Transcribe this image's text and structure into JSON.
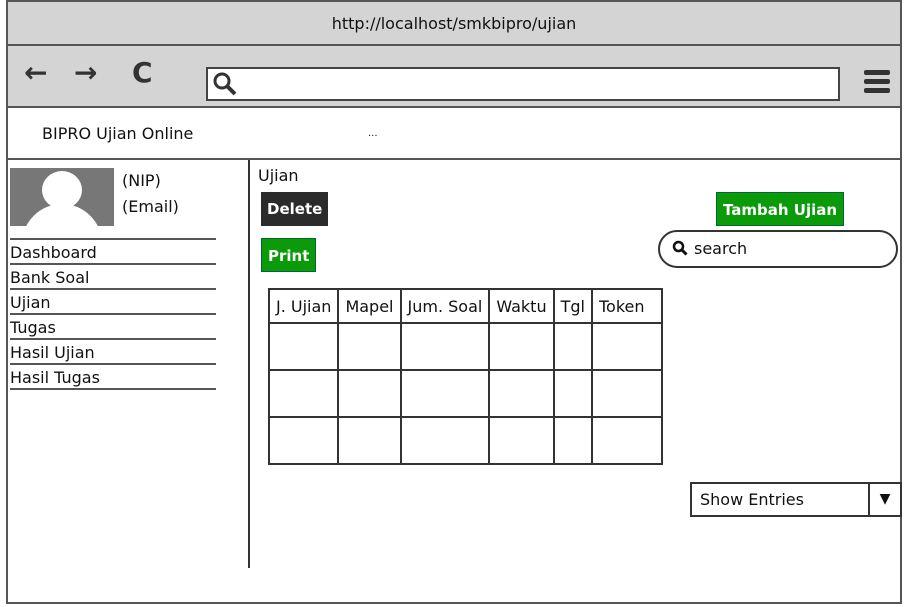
{
  "browser": {
    "url": "http://localhost/smkbipro/ujian",
    "back_icon": "←",
    "forward_icon": "→",
    "reload_icon": "C",
    "search_icon": "⚲"
  },
  "app": {
    "brand": "BIPRO Ujian Online",
    "dots": "..."
  },
  "profile": {
    "nip": "(NIP)",
    "email": "(Email)"
  },
  "sidebar": {
    "items": [
      {
        "label": "Dashboard"
      },
      {
        "label": "Bank Soal"
      },
      {
        "label": "Ujian"
      },
      {
        "label": "Tugas"
      },
      {
        "label": "Hasil Ujian"
      },
      {
        "label": "Hasil Tugas"
      }
    ]
  },
  "main": {
    "title": "Ujian",
    "delete_label": "Delete",
    "print_label": "Print",
    "add_label": "Tambah Ujian",
    "search_placeholder": "search",
    "table": {
      "columns": [
        "J. Ujian",
        "Mapel",
        "Jum. Soal",
        "Waktu",
        "Tgl",
        "Token"
      ]
    },
    "entries_label": "Show Entries"
  },
  "colors": {
    "accent_green": "#0a9a0a",
    "dark_button": "#2b2b2b",
    "chrome_gray": "#d4d4d4"
  }
}
